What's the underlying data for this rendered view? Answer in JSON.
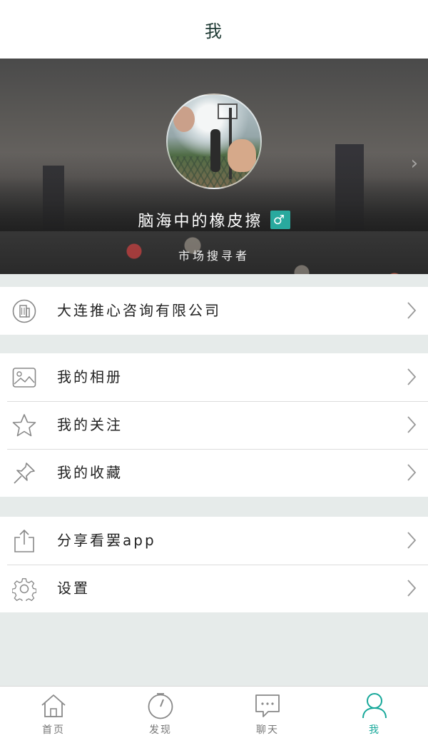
{
  "header": {
    "title": "我"
  },
  "profile": {
    "username": "脑海中的橡皮擦",
    "gender_symbol": "♂",
    "role": "市场搜寻者"
  },
  "groups": [
    {
      "items": [
        {
          "icon": "building-icon",
          "label": "大连推心咨询有限公司"
        }
      ]
    },
    {
      "items": [
        {
          "icon": "image-icon",
          "label": "我的相册"
        },
        {
          "icon": "star-icon",
          "label": "我的关注"
        },
        {
          "icon": "pin-icon",
          "label": "我的收藏"
        }
      ]
    },
    {
      "items": [
        {
          "icon": "share-icon",
          "label": "分享看罢app"
        },
        {
          "icon": "gear-icon",
          "label": "设置"
        }
      ]
    }
  ],
  "tabbar": {
    "active_color": "#17a89a",
    "tabs": [
      {
        "icon": "home-icon",
        "label": "首页"
      },
      {
        "icon": "discover-icon",
        "label": "发现"
      },
      {
        "icon": "chat-icon",
        "label": "聊天"
      },
      {
        "icon": "user-icon",
        "label": "我"
      }
    ]
  }
}
